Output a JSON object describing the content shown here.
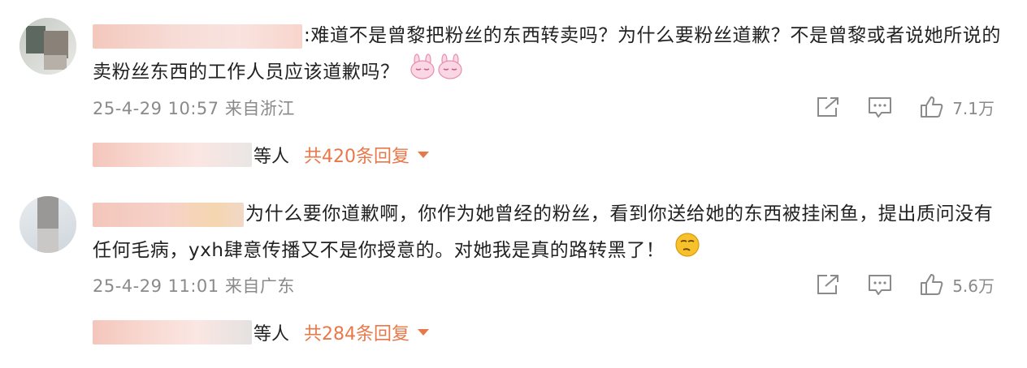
{
  "comments": [
    {
      "text": ":难道不是曾黎把粉丝的东西转卖吗？为什么要粉丝道歉？不是曾黎或者说她所说的卖粉丝东西的工作人员应该道歉吗？",
      "emoji": "bunny-emoji",
      "meta": "25-4-29 10:57 来自浙江",
      "likes": "7.1万",
      "replies_suffix": "等人",
      "replies_count": "共420条回复"
    },
    {
      "text": "为什么要你道歉啊，你作为她曾经的粉丝，看到你送给她的东西被挂闲鱼，提出质问没有任何毛病，yxh肆意传播又不是你授意的。对她我是真的路转黑了！",
      "emoji": "smirk-emoji",
      "meta": "25-4-29 11:01 来自广东",
      "likes": "5.6万",
      "replies_suffix": "等人",
      "replies_count": "共284条回复"
    }
  ],
  "colors": {
    "accent": "#e8784a",
    "meta_gray": "#8a8a8a",
    "text": "#222222"
  }
}
